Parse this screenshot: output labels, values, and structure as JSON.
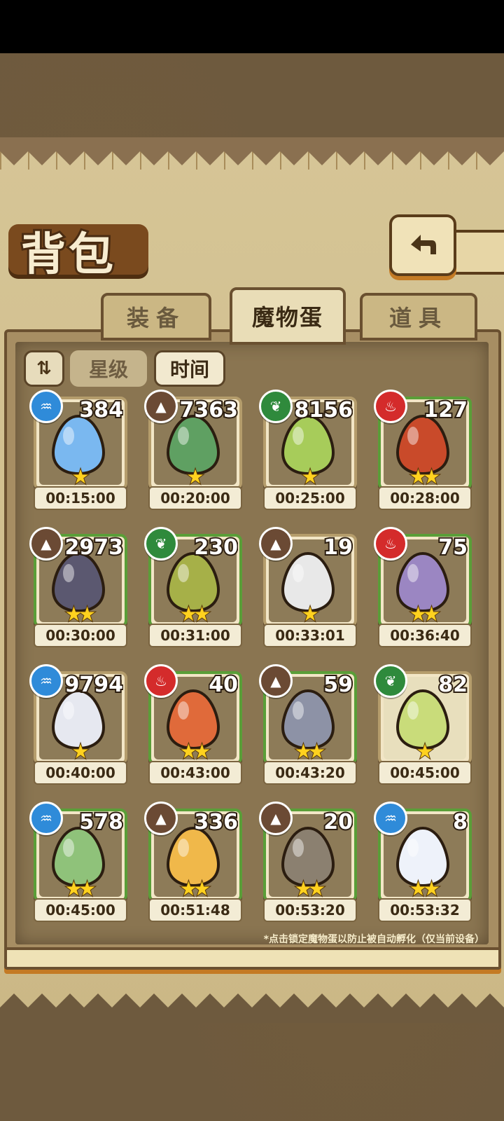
{
  "header": {
    "title": "背包"
  },
  "tabs": [
    {
      "label": "装备",
      "active": false
    },
    {
      "label": "魔物蛋",
      "active": true
    },
    {
      "label": "道具",
      "active": false
    }
  ],
  "sort": {
    "icon": "sort-order-icon",
    "star_label": "星级",
    "time_label": "时间",
    "selected": "时间"
  },
  "eggs": [
    {
      "element": "water",
      "count": "384",
      "stars": 1,
      "time": "00:15:00",
      "color": "#7ab8f0",
      "frame": "plain"
    },
    {
      "element": "earth",
      "count": "7363",
      "stars": 1,
      "time": "00:20:00",
      "color": "#5fa062",
      "frame": "plain"
    },
    {
      "element": "grass",
      "count": "8156",
      "stars": 1,
      "time": "00:25:00",
      "color": "#a7cc5a",
      "frame": "plain"
    },
    {
      "element": "fire",
      "count": "127",
      "stars": 2,
      "time": "00:28:00",
      "color": "#c94a2a",
      "frame": "green"
    },
    {
      "element": "earth",
      "count": "2973",
      "stars": 2,
      "time": "00:30:00",
      "color": "#5b5870",
      "frame": "green"
    },
    {
      "element": "grass",
      "count": "230",
      "stars": 2,
      "time": "00:31:00",
      "color": "#a6b048",
      "frame": "green"
    },
    {
      "element": "earth",
      "count": "19",
      "stars": 1,
      "time": "00:33:01",
      "color": "#e8e8e8",
      "frame": "plain"
    },
    {
      "element": "fire",
      "count": "75",
      "stars": 2,
      "time": "00:36:40",
      "color": "#9b86c2",
      "frame": "green"
    },
    {
      "element": "water",
      "count": "9794",
      "stars": 1,
      "time": "00:40:00",
      "color": "#e6e8f0",
      "frame": "plain"
    },
    {
      "element": "fire",
      "count": "40",
      "stars": 2,
      "time": "00:43:00",
      "color": "#e06a3a",
      "frame": "green"
    },
    {
      "element": "earth",
      "count": "59",
      "stars": 2,
      "time": "00:43:20",
      "color": "#8d92a6",
      "frame": "green"
    },
    {
      "element": "grass",
      "count": "82",
      "stars": 1,
      "time": "00:45:00",
      "color": "#c9dc7a",
      "frame": "light"
    },
    {
      "element": "water",
      "count": "578",
      "stars": 2,
      "time": "00:45:00",
      "color": "#8fc27a",
      "frame": "green"
    },
    {
      "element": "earth",
      "count": "336",
      "stars": 2,
      "time": "00:51:48",
      "color": "#f0b84a",
      "frame": "green"
    },
    {
      "element": "earth",
      "count": "20",
      "stars": 2,
      "time": "00:53:20",
      "color": "#8b8070",
      "frame": "green"
    },
    {
      "element": "water",
      "count": "8",
      "stars": 2,
      "time": "00:53:32",
      "color": "#eef2fa",
      "frame": "green"
    }
  ],
  "hint": "*点击锁定魔物蛋以防止被自动孵化（仅当前设备）",
  "icons": {
    "water": "♒",
    "earth": "▲",
    "grass": "❦",
    "fire": "♨",
    "back": "back-arrow-icon"
  }
}
